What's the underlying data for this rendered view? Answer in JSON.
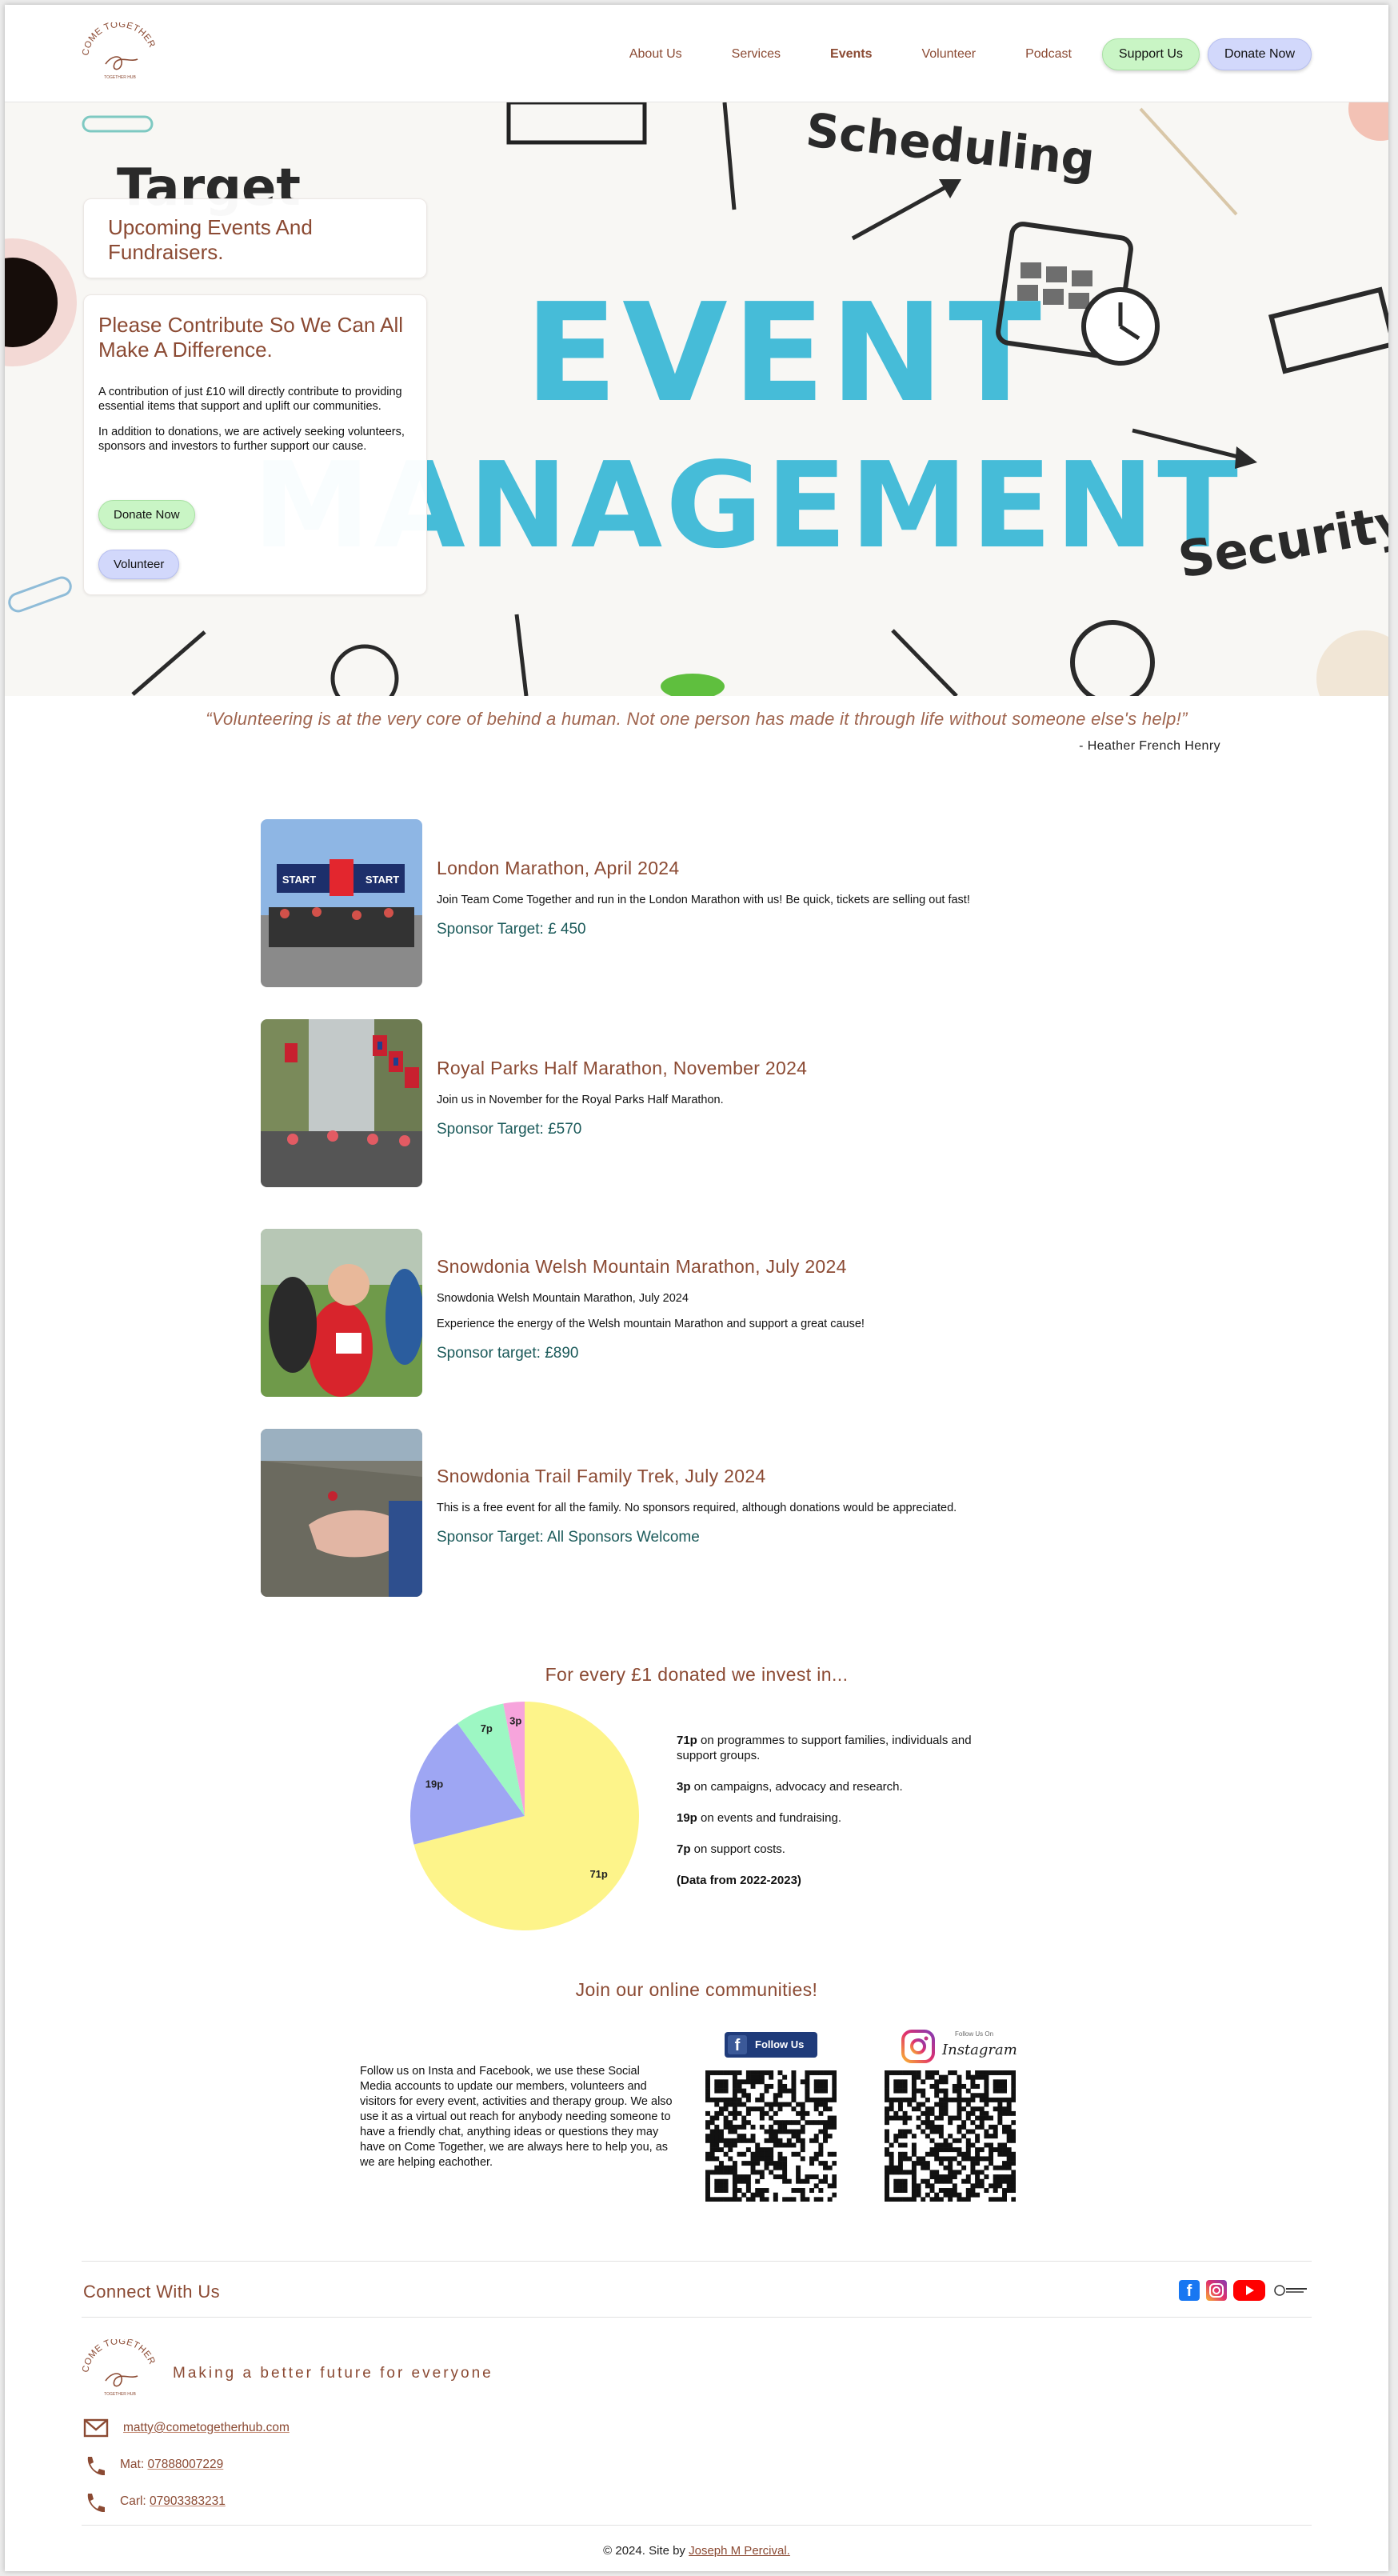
{
  "brand": {
    "logo_text": "COME TOGETHER",
    "logo_sub": "TOGETHER HUB",
    "accent": "#8b4a33",
    "green": "#c9f5c5",
    "blue": "#d2d8fb",
    "teal": "#1b5a5a"
  },
  "nav": {
    "items": [
      "About Us",
      "Services",
      "Events",
      "Volunteer",
      "Podcast"
    ],
    "active": "Events",
    "support_label": "Support Us",
    "donate_label": "Donate Now"
  },
  "hero": {
    "image_words": [
      "Target",
      "Scheduling",
      "EVENT",
      "MANAGEMENT",
      "Security"
    ],
    "card1_title": "Upcoming Events And Fundraisers.",
    "card2_title": "Please Contribute So We Can All Make A Difference.",
    "card2_p1": "A contribution of just £10 will directly contribute to providing essential items that support and uplift our communities.",
    "card2_p2": "In addition to donations, we are actively seeking volunteers, sponsors and investors to further support our cause.",
    "donate_label": "Donate Now",
    "volunteer_label": "Volunteer"
  },
  "quote": {
    "text": "“Volunteering is at the very core of behind a human. Not one person has made it through life without someone else's help!”",
    "author": "- Heather French Henry"
  },
  "events": [
    {
      "title": "London Marathon, April 2024",
      "lines": [
        "Join Team Come Together and run in the London Marathon with us! Be quick, tickets are selling out fast!"
      ],
      "target": "Sponsor Target: £ 450",
      "photo_text": [
        "START",
        "START"
      ]
    },
    {
      "title": "Royal Parks Half Marathon, November 2024",
      "lines": [
        "Join us in November for the Royal Parks Half Marathon."
      ],
      "target": "Sponsor Target: £570"
    },
    {
      "title": "Snowdonia Welsh Mountain Marathon, July 2024",
      "lines": [
        "Snowdonia Welsh Mountain Marathon, July 2024",
        "Experience the energy of the Welsh mountain Marathon and support a great cause!"
      ],
      "target": "Sponsor target: £890"
    },
    {
      "title": "Snowdonia Trail Family Trek, July 2024",
      "lines": [
        "This is a free event for all the family. No sponsors required, although donations would be appreciated."
      ],
      "target": "Sponsor Target: All Sponsors Welcome"
    }
  ],
  "donation": {
    "title": "For every £1 donated we invest in...",
    "legend": [
      {
        "value": "71p",
        "text": " on programmes to support families, individuals and support groups."
      },
      {
        "value": "3p",
        "text": " on campaigns, advocacy and research."
      },
      {
        "value": "19p",
        "text": " on events and fundraising."
      },
      {
        "value": "7p",
        "text": " on support costs."
      }
    ],
    "note": "(Data from 2022-2023)"
  },
  "chart_data": {
    "type": "pie",
    "title": "",
    "categories": [
      "Programmes",
      "Events and fundraising",
      "Support costs",
      "Campaigns"
    ],
    "values": [
      71,
      19,
      7,
      3
    ],
    "labels": [
      "71p",
      "19p",
      "7p",
      "3p"
    ],
    "colors": [
      "#fdf48a",
      "#9ea6f3",
      "#9df7c3",
      "#f7a4dc"
    ]
  },
  "social": {
    "title": "Join our online communities!",
    "text": "Follow us on Insta and Facebook, we use these Social Media accounts to update our members, volunteers and visitors for every event, activities and therapy group. We also use it as a virtual out reach for anybody needing someone to have a friendly chat, anything ideas or questions they may have on Come Together, we are always here to help you, as we are helping eachother.",
    "fb_label": "Follow Us",
    "ig_small": "Follow Us On",
    "ig_label": "Instagram"
  },
  "footer": {
    "connect_title": "Connect With Us",
    "tagline": "Making a better future for everyone",
    "email": "matty@cometogetherhub.com",
    "matt_label": "Mat: ",
    "matt_phone": "07888007229",
    "carl_label": "Carl: ",
    "carl_phone": "07903383231",
    "copyright": "© 2024. Site by ",
    "credit": "Joseph M Percival."
  }
}
